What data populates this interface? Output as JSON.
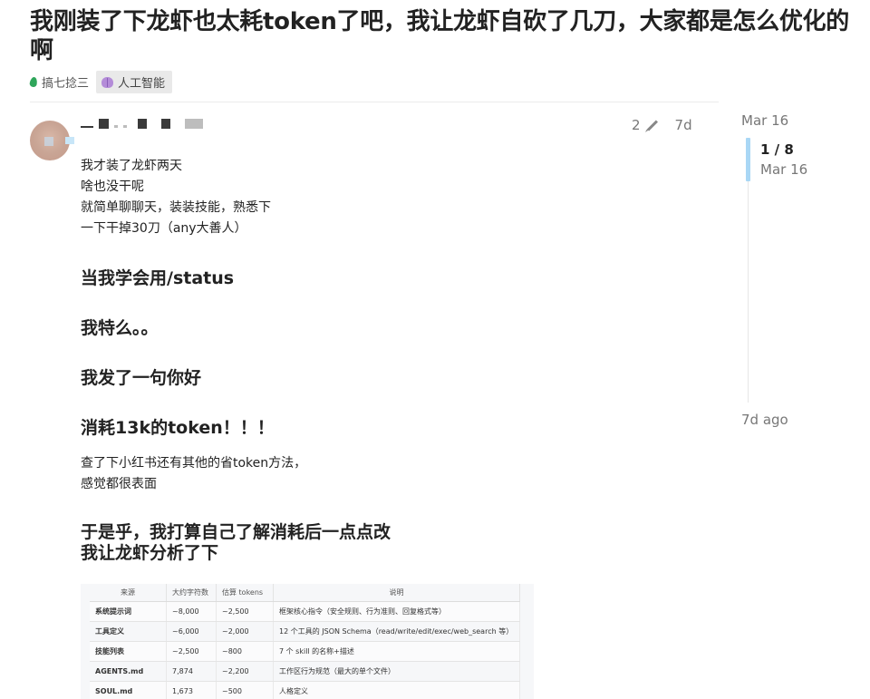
{
  "topic": {
    "title": "我刚装了下龙虾也太耗token了吧，我让龙虾自砍了几刀，大家都是怎么优化的啊",
    "category": "搞七捻三",
    "tag": "人工智能"
  },
  "post": {
    "username": "",
    "edits": "2",
    "age": "7d",
    "lines1": [
      "我才装了龙虾两天",
      "啥也没干呢",
      "就简单聊聊天，装装技能，熟悉下",
      "一下干掉30刀（any大善人）"
    ],
    "heading1": "当我学会用/status",
    "heading2": "我特么。。",
    "heading3": "我发了一句你好",
    "heading4": "消耗13k的token！！！",
    "lines2": [
      "查了下小红书还有其他的省token方法，",
      "感觉都很表面"
    ],
    "heading5a": "于是乎，我打算自己了解消耗后一点点改",
    "heading5b": "我让龙虾分析了下"
  },
  "screenshot_table": {
    "headers": [
      "来源",
      "大约字符数",
      "估算 tokens",
      "说明"
    ],
    "rows": [
      [
        "系统提示词",
        "~8,000",
        "~2,500",
        "框架核心指令（安全规则、行为准则、回复格式等）"
      ],
      [
        "工具定义",
        "~6,000",
        "~2,000",
        "12 个工具的 JSON Schema（read/write/edit/exec/web_search 等）"
      ],
      [
        "技能列表",
        "~2,500",
        "~800",
        "7 个 skill 的名称+描述"
      ],
      [
        "AGENTS.md",
        "7,874",
        "~2,200",
        "工作区行为规范（最大的单个文件）"
      ],
      [
        "SOUL.md",
        "1,673",
        "~500",
        "人格定义"
      ]
    ]
  },
  "timeline": {
    "start_date": "Mar 16",
    "position": "1 / 8",
    "current_date": "Mar 16",
    "end_label": "7d ago"
  }
}
